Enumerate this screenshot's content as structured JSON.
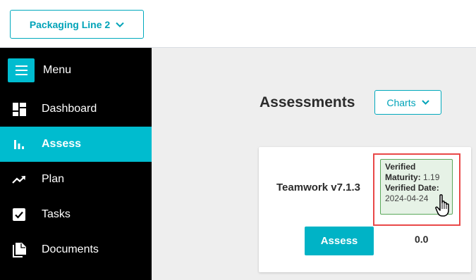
{
  "header": {
    "line_select_label": "Packaging Line 2"
  },
  "sidebar": {
    "menu_label": "Menu",
    "items": [
      {
        "label": "Dashboard",
        "icon": "dashboard-icon",
        "active": false
      },
      {
        "label": "Assess",
        "icon": "bar-chart-icon",
        "active": true
      },
      {
        "label": "Plan",
        "icon": "trending-up-icon",
        "active": false
      },
      {
        "label": "Tasks",
        "icon": "checkbox-icon",
        "active": false
      },
      {
        "label": "Documents",
        "icon": "documents-icon",
        "active": false
      }
    ]
  },
  "main": {
    "title": "Assessments",
    "charts_label": "Charts",
    "card": {
      "name": "Teamwork v7.1.3",
      "verified_maturity_label": "Verified Maturity:",
      "verified_maturity_value": "1.19",
      "verified_date_label": "Verified Date:",
      "verified_date_value": "2024-04-24",
      "assess_button": "Assess",
      "score": "0.0"
    }
  },
  "colors": {
    "accent": "#00bccf",
    "highlight_border": "#e94848",
    "badge_bg": "#e6f2e6"
  }
}
